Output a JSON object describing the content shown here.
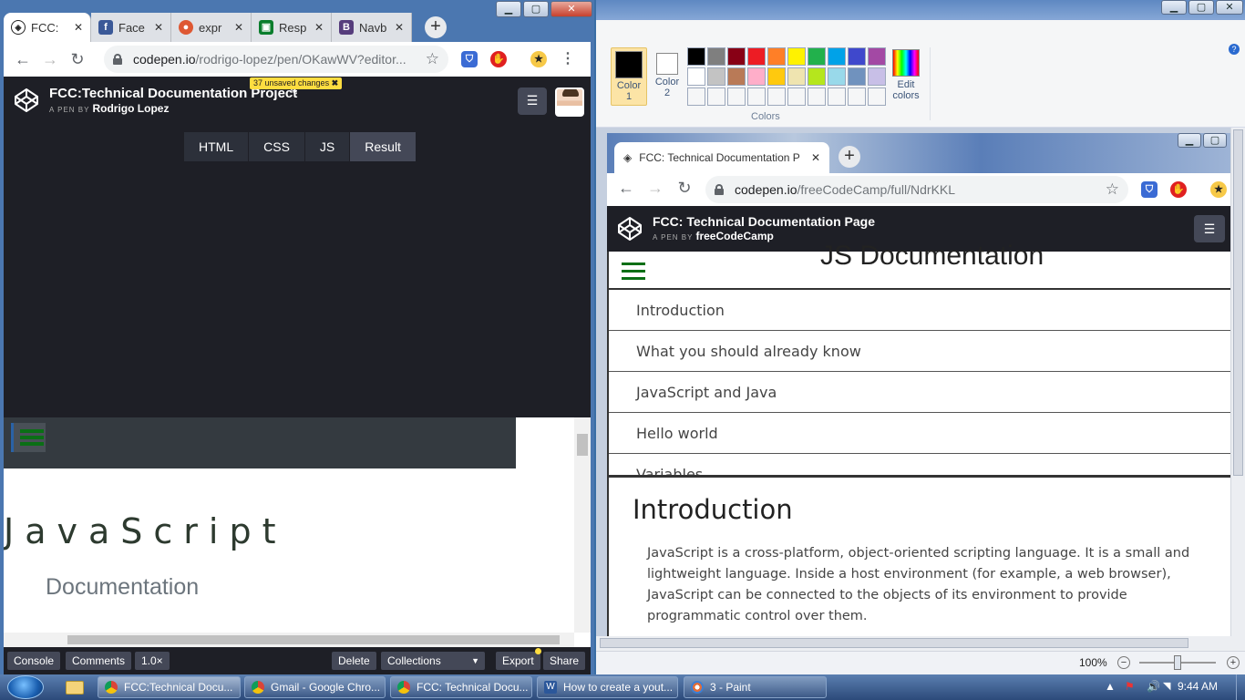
{
  "left_window": {
    "tabs": [
      {
        "label": "FCC:",
        "icon": "codepen-icon",
        "color": "#222"
      },
      {
        "label": "Face",
        "icon": "facebook-icon",
        "color": "#3b5998"
      },
      {
        "label": "expr",
        "icon": "duckduckgo-icon",
        "color": "#de5833"
      },
      {
        "label": "Resp",
        "icon": "responsive-icon",
        "color": "#0a7d2c"
      },
      {
        "label": "Navb",
        "icon": "bootstrap-icon",
        "color": "#563d7c"
      }
    ],
    "url_host": "codepen.io",
    "url_path": "/rodrigo-lopez/pen/OKawWV?editor...",
    "codepen": {
      "title": "FCC:Technical Documentation Project",
      "by_prefix": "A PEN BY",
      "author": "Rodrigo Lopez",
      "unsaved": "37 unsaved changes",
      "editor_tabs": [
        "HTML",
        "CSS",
        "JS",
        "Result"
      ],
      "result_title": "JavaScript",
      "result_subtitle": "Documentation",
      "footer_left": [
        "Console",
        "Comments",
        "1.0×"
      ],
      "footer_delete": "Delete",
      "footer_collections": "Collections",
      "footer_export": "Export",
      "footer_share": "Share"
    }
  },
  "paint": {
    "color1_label": "Color 1",
    "color1_label_a": "Color",
    "color1_label_b": "1",
    "color2_label_a": "Color",
    "color2_label_b": "2",
    "edit_colors_a": "Edit",
    "edit_colors_b": "colors",
    "colors_group": "Colors",
    "palette": [
      "#000000",
      "#7f7f7f",
      "#880015",
      "#ed1c24",
      "#ff7f27",
      "#fff200",
      "#22b14c",
      "#00a2e8",
      "#3f48cc",
      "#a349a4",
      "#ffffff",
      "#c3c3c3",
      "#b97a57",
      "#ffaec9",
      "#ffc90e",
      "#efe4b0",
      "#b5e61d",
      "#99d9ea",
      "#7092be",
      "#c8bfe7",
      "#f5f6f7",
      "#f5f6f7",
      "#f5f6f7",
      "#f5f6f7",
      "#f5f6f7",
      "#f5f6f7",
      "#f5f6f7",
      "#f5f6f7",
      "#f5f6f7",
      "#f5f6f7"
    ],
    "zoom": "100%",
    "pasted": {
      "tab_label": "FCC: Technical Documentation P",
      "url_host": "codepen.io",
      "url_path": "/freeCodeCamp/full/NdrKKL",
      "title": "FCC: Technical Documentation Page",
      "by_prefix": "A PEN BY",
      "author": "freeCodeCamp",
      "heading": "JS Documentation",
      "nav": [
        "Introduction",
        "What you should already know",
        "JavaScript and Java",
        "Hello world",
        "Variables"
      ],
      "section_title": "Introduction",
      "section_text": "JavaScript is a cross-platform, object-oriented scripting language. It is a small and lightweight language. Inside a host environment (for example, a web browser), JavaScript can be connected to the objects of its environment to provide programmatic control over them."
    }
  },
  "taskbar": {
    "tasks": [
      {
        "label": "FCC:Technical Docu...",
        "icon": "chrome-icon",
        "active": true
      },
      {
        "label": "Gmail - Google Chro...",
        "icon": "chrome-icon",
        "active": false
      },
      {
        "label": "FCC: Technical Docu...",
        "icon": "chrome-icon",
        "active": false
      },
      {
        "label": "How to create a yout...",
        "icon": "word-icon",
        "active": false
      },
      {
        "label": "3 - Paint",
        "icon": "paint-icon",
        "active": false
      }
    ],
    "time": "9:44 AM"
  }
}
